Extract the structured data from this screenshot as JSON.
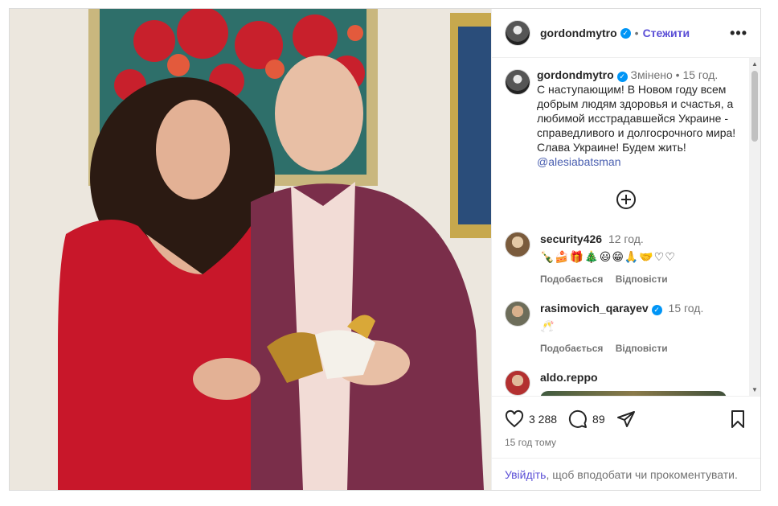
{
  "post": {
    "username": "gordondmytro",
    "follow_label": "Стежити",
    "more_label": "•••"
  },
  "caption": {
    "username": "gordondmytro",
    "edited": "Змінено",
    "dot": "•",
    "time": "15 год.",
    "text": "С наступающим! В Новом году всем добрым людям здоровья и счастья, а любимой исстрадавшейся Украине - справедливого и долгосрочного мира! Слава Украине! Будем жить!",
    "mention": "@alesiabatsman"
  },
  "comments": [
    {
      "username": "security426",
      "time": "12 год.",
      "text": "🍾🍰🎁🎄😃😁🙏🤝♡♡",
      "like_label": "Подобається",
      "reply_label": "Відповісти"
    },
    {
      "username": "rasimovich_qarayev",
      "time": "15 год.",
      "text": "🥂",
      "like_label": "Подобається",
      "reply_label": "Відповісти"
    },
    {
      "username": "aldo.reppo",
      "time": "",
      "text": "",
      "like_label": "",
      "reply_label": ""
    }
  ],
  "stats": {
    "likes": "3 288",
    "comments": "89",
    "time_ago": "15 год тому"
  },
  "login": {
    "link": "Увійдіть",
    "text": ", щоб вподобати чи прокоментувати."
  },
  "colors": {
    "accent": "#5b4fd6",
    "verified": "#0095f6",
    "dress": "#c8172a",
    "jacket": "#7a2e4a"
  }
}
